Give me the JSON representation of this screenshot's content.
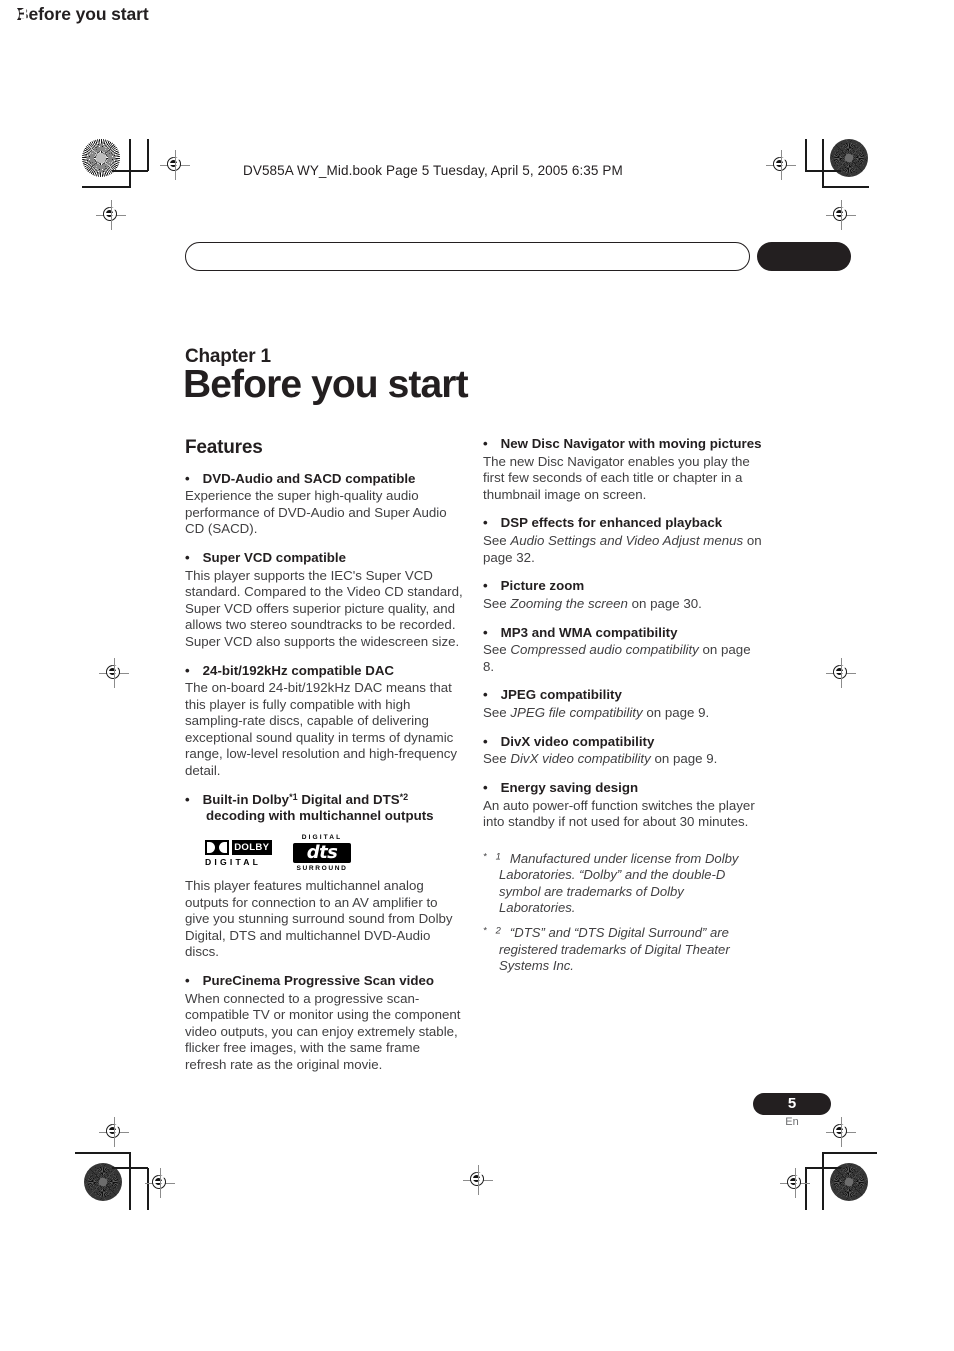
{
  "printmark_filename": "DV585A WY_Mid.book  Page 5  Tuesday, April 5, 2005  6:35 PM",
  "running_head": {
    "title": "Before you start",
    "chapter_number": "01"
  },
  "chapter": {
    "label": "Chapter 1",
    "title": "Before you start"
  },
  "features_heading": "Features",
  "left_column": {
    "features": [
      {
        "title": "DVD-Audio and SACD compatible",
        "body": "Experience the super high-quality audio performance of DVD-Audio and Super Audio CD (SACD)."
      },
      {
        "title": "Super VCD compatible",
        "body": "This player supports the IEC's Super VCD standard. Compared to the Video CD standard, Super VCD offers superior picture quality, and allows two stereo soundtracks to be recorded. Super VCD also supports the widescreen size."
      },
      {
        "title": "24-bit/192kHz compatible DAC",
        "body": "The on-board 24-bit/192kHz DAC means that this player is fully compatible with high sampling-rate discs, capable of delivering exceptional sound quality in terms of dynamic range, low-level resolution and high-frequency detail."
      }
    ],
    "dolby_feature": {
      "title_part1": "Built-in Dolby",
      "sup1": "*1",
      "title_part2": " Digital and DTS",
      "sup2": "*2",
      "title_part3": "decoding with multichannel outputs",
      "body": "This player features multichannel analog outputs for connection to an AV amplifier to give you stunning surround sound from Dolby Digital, DTS and multichannel DVD-Audio discs."
    },
    "logos": {
      "dolby_word": "DOLBY",
      "dolby_digital": "DIGITAL",
      "dts_top": "DIGITAL",
      "dts_mark": "dts",
      "dts_bottom": "SURROUND"
    },
    "purecinema": {
      "title": "PureCinema Progressive Scan video",
      "body": "When connected to a progressive scan-compatible TV or monitor using the component video outputs, you can enjoy extremely stable, flicker free images, with the same frame refresh rate as the original movie."
    }
  },
  "right_column": {
    "features": [
      {
        "title": "New Disc Navigator with moving pictures",
        "body_pre": "The new Disc Navigator enables you play the first few seconds of each title or chapter in a thumbnail image on screen.",
        "italic": "",
        "body_post": ""
      },
      {
        "title": "DSP effects for enhanced playback",
        "body_pre": "See ",
        "italic": "Audio Settings and Video Adjust menus",
        "body_post": " on page 32."
      },
      {
        "title": "Picture zoom",
        "body_pre": "See ",
        "italic": "Zooming the screen",
        "body_post": " on page 30."
      },
      {
        "title": "MP3 and WMA compatibility",
        "body_pre": "See ",
        "italic": "Compressed audio compatibility",
        "body_post": " on page 8."
      },
      {
        "title": "JPEG compatibility",
        "body_pre": "See ",
        "italic": "JPEG file compatibility",
        "body_post": " on page 9."
      },
      {
        "title": "DivX video compatibility",
        "body_pre": "See ",
        "italic": "DivX video compatibility",
        "body_post": " on page 9."
      },
      {
        "title": "Energy saving design",
        "body_pre": "An auto power-off function switches the player into standby if not used for about 30 minutes.",
        "italic": "",
        "body_post": ""
      }
    ],
    "footnotes": [
      {
        "mark": "*1",
        "text": "Manufactured under license from Dolby Laboratories. “Dolby” and the double-D symbol are trademarks of Dolby Laboratories."
      },
      {
        "mark": "*2",
        "text": "“DTS” and “DTS Digital Surround” are registered trademarks of Digital Theater Systems Inc."
      }
    ]
  },
  "footer": {
    "page_number": "5",
    "language": "En"
  },
  "colors": {
    "ink": "#231f20",
    "body_text": "#414042",
    "paper": "#ffffff"
  }
}
